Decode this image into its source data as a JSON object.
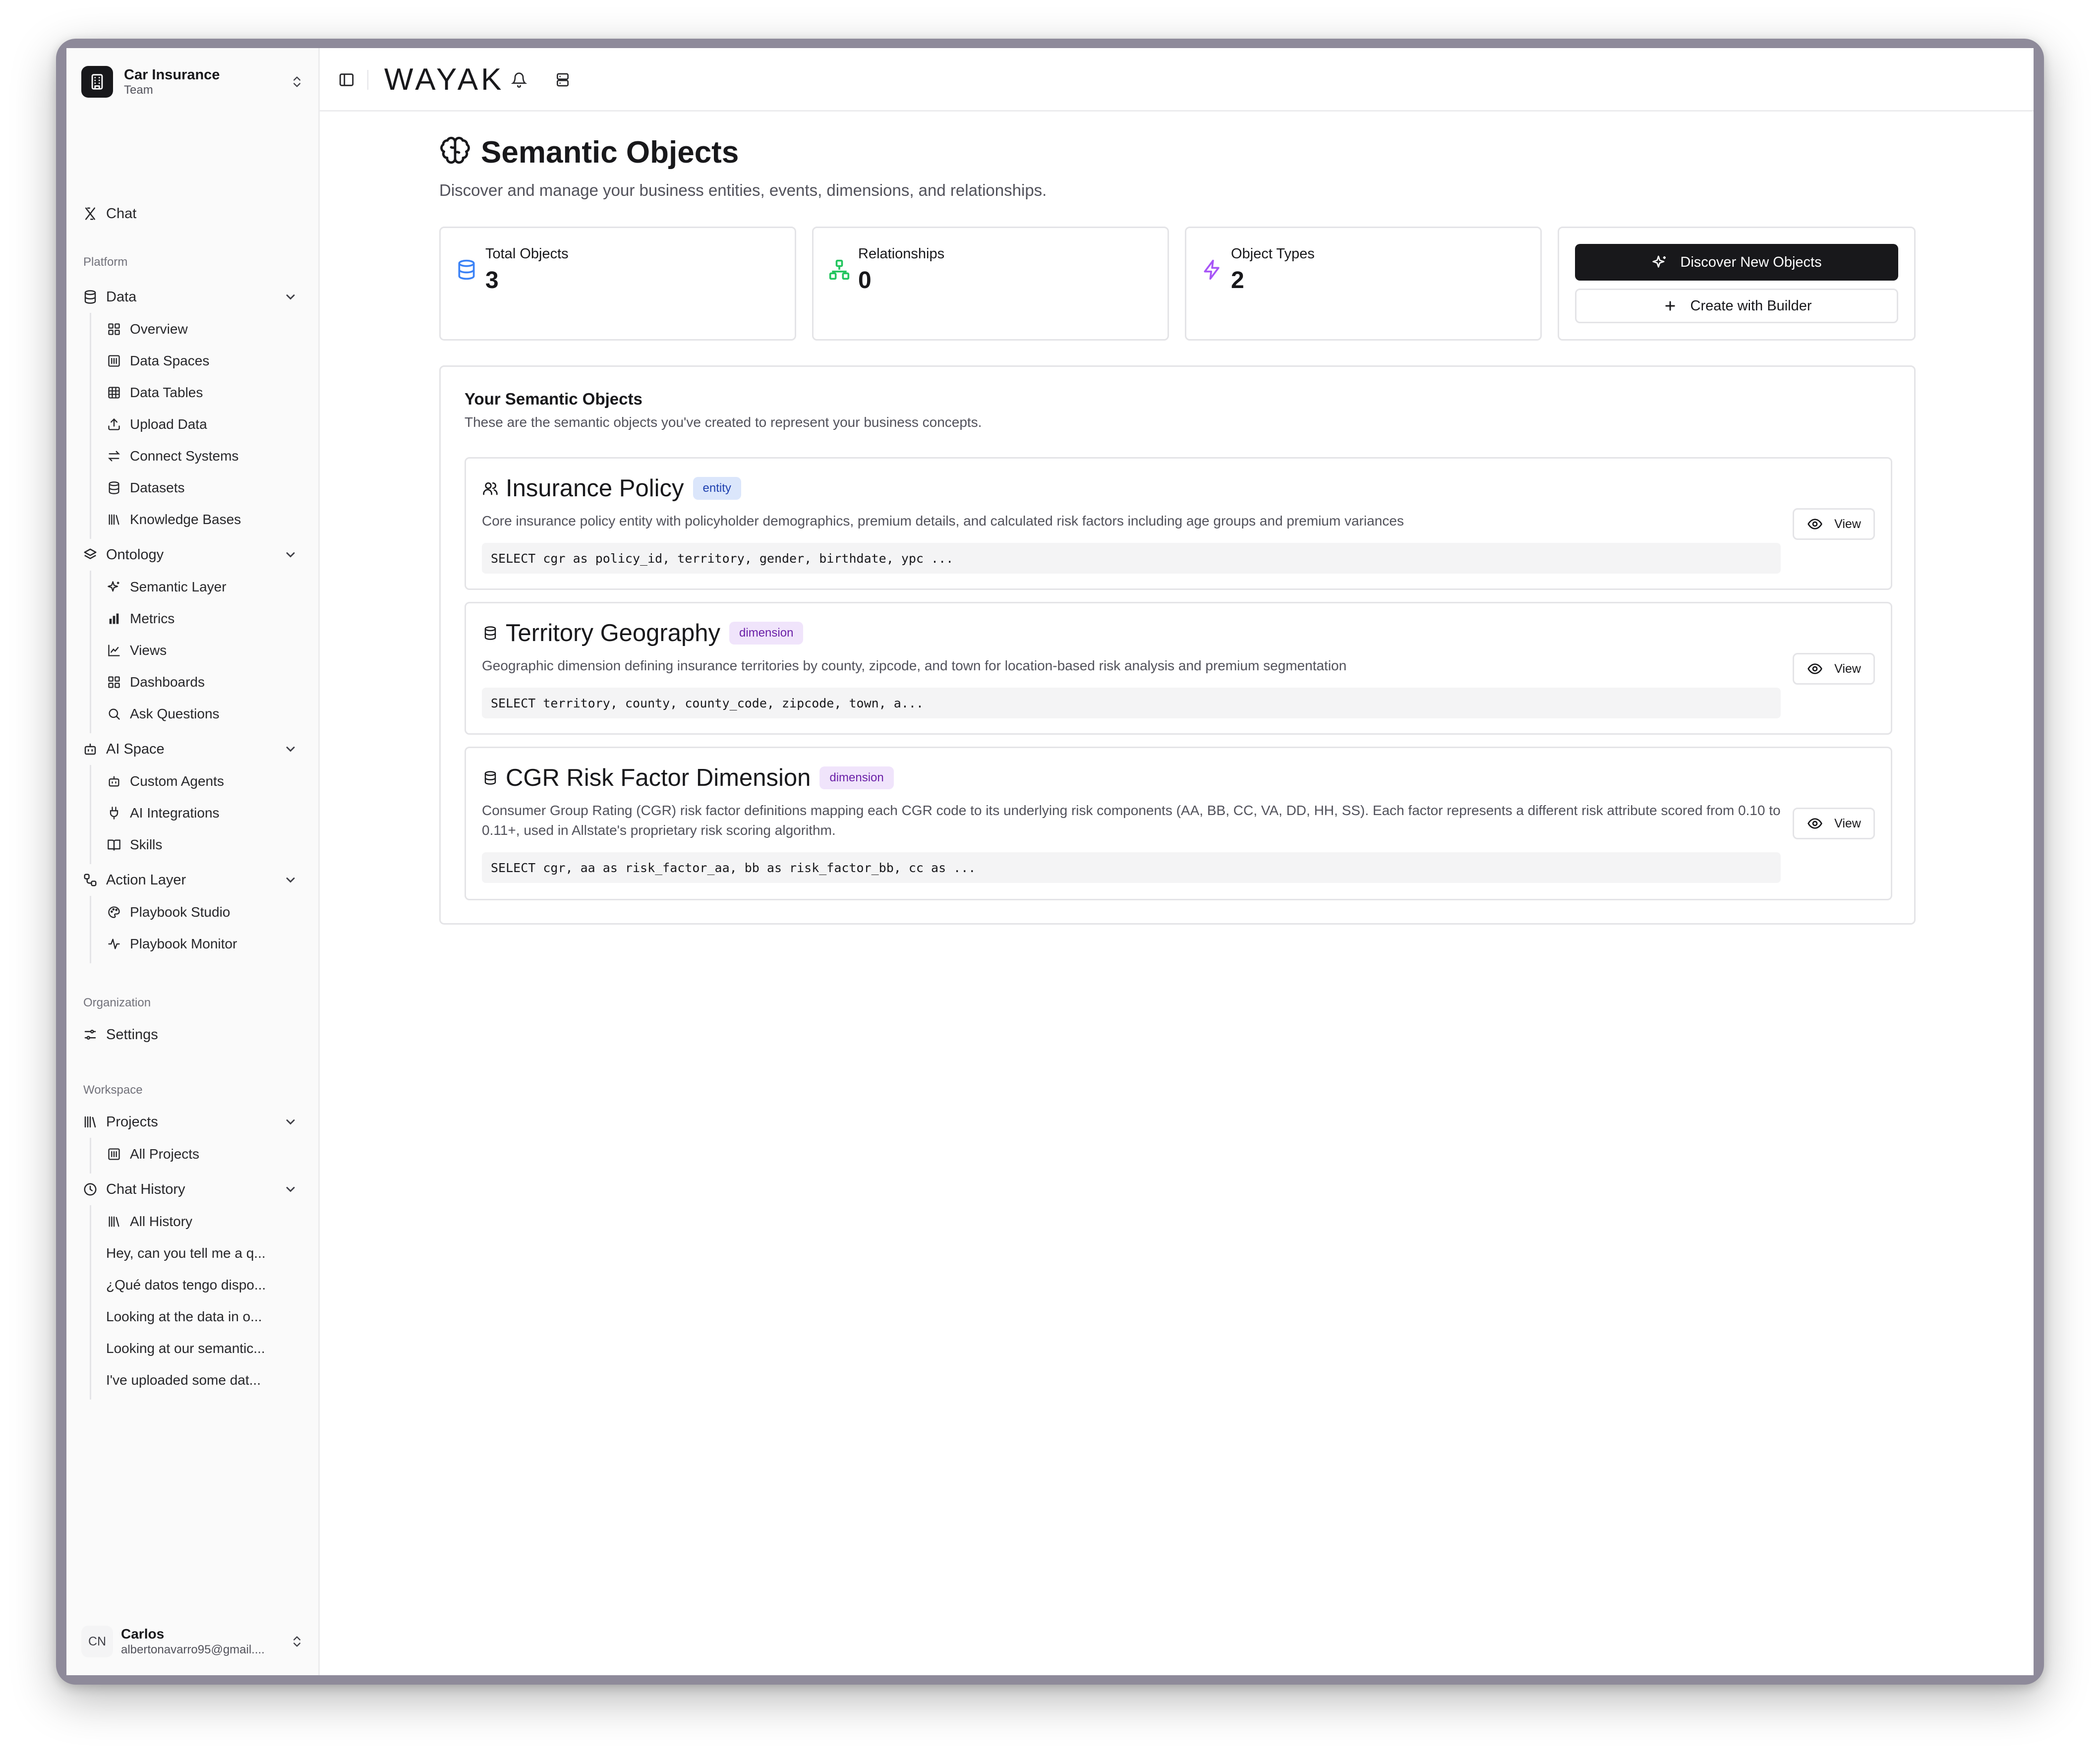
{
  "team": {
    "name": "Car Insurance",
    "subtitle": "Team"
  },
  "sidebar": {
    "chat_label": "Chat",
    "platform_label": "Platform",
    "data": {
      "label": "Data",
      "items": [
        "Overview",
        "Data Spaces",
        "Data Tables",
        "Upload Data",
        "Connect Systems",
        "Datasets",
        "Knowledge Bases"
      ]
    },
    "ontology": {
      "label": "Ontology",
      "items": [
        "Semantic Layer",
        "Metrics",
        "Views",
        "Dashboards",
        "Ask Questions"
      ]
    },
    "ai_space": {
      "label": "AI Space",
      "items": [
        "Custom Agents",
        "AI Integrations",
        "Skills"
      ]
    },
    "action_layer": {
      "label": "Action Layer",
      "items": [
        "Playbook Studio",
        "Playbook Monitor"
      ]
    },
    "organization_label": "Organization",
    "settings_label": "Settings",
    "workspace_label": "Workspace",
    "projects": {
      "label": "Projects",
      "items": [
        "All Projects"
      ]
    },
    "chat_history": {
      "label": "Chat History",
      "all_label": "All History",
      "items": [
        "Hey, can you tell me a q...",
        "¿Qué datos tengo dispo...",
        "Looking at the data in o...",
        "Looking at our semantic...",
        "I've uploaded some dat..."
      ]
    }
  },
  "user": {
    "initials": "CN",
    "name": "Carlos",
    "email": "albertonavarro95@gmail...."
  },
  "topbar": {
    "brand": "WAYAK"
  },
  "page": {
    "title": "Semantic Objects",
    "subtitle": "Discover and manage your business entities, events, dimensions, and relationships."
  },
  "stats": [
    {
      "label": "Total Objects",
      "value": "3",
      "icon": "database-icon",
      "color": "#3b82f6"
    },
    {
      "label": "Relationships",
      "value": "0",
      "icon": "network-icon",
      "color": "#22c55e"
    },
    {
      "label": "Object Types",
      "value": "2",
      "icon": "zap-icon",
      "color": "#a855f7"
    }
  ],
  "actions": {
    "discover_label": "Discover New Objects",
    "builder_label": "Create with Builder"
  },
  "objects_panel": {
    "title": "Your Semantic Objects",
    "subtitle": "These are the semantic objects you've created to represent your business concepts.",
    "view_label": "View",
    "items": [
      {
        "name": "Insurance Policy",
        "badge": "entity",
        "description": "Core insurance policy entity with policyholder demographics, premium details, and calculated risk factors including age groups and premium variances",
        "sql": "SELECT cgr as policy_id, territory, gender, birthdate, ypc ..."
      },
      {
        "name": "Territory Geography",
        "badge": "dimension",
        "description": "Geographic dimension defining insurance territories by county, zipcode, and town for location-based risk analysis and premium segmentation",
        "sql": "SELECT territory, county, county_code, zipcode, town, a..."
      },
      {
        "name": "CGR Risk Factor Dimension",
        "badge": "dimension",
        "description": "Consumer Group Rating (CGR) risk factor definitions mapping each CGR code to its underlying risk components (AA, BB, CC, VA, DD, HH, SS). Each factor represents a different risk attribute scored from 0.10 to 0.11+, used in Allstate's proprietary risk scoring algorithm.",
        "sql": "SELECT cgr, aa as risk_factor_aa, bb as risk_factor_bb, cc as ..."
      }
    ]
  },
  "colors": {
    "accent": "#18181b",
    "entity_badge": "#dbe6fb",
    "dimension_badge": "#f0e4fb"
  }
}
